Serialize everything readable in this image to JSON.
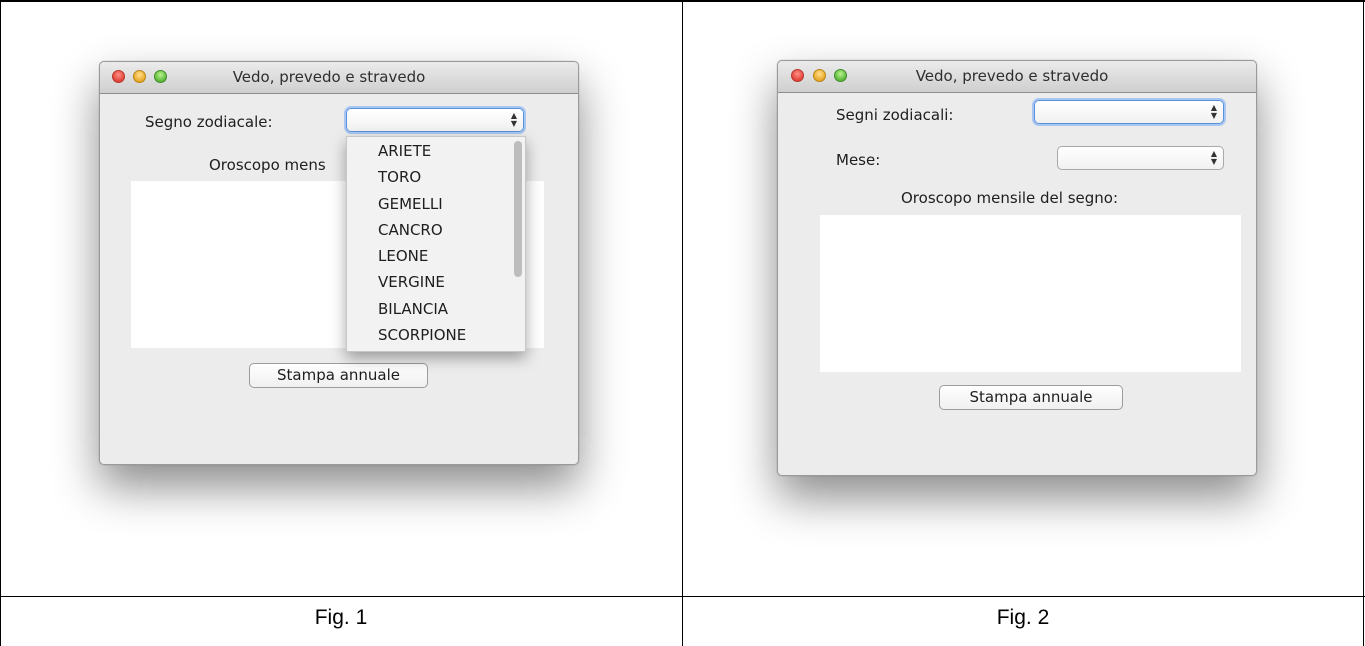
{
  "figures": [
    {
      "caption": "Fig. 1",
      "window": {
        "title": "Vedo, prevedo e stravedo",
        "sign_label": "Segno zodiacale:",
        "sign_value": "",
        "horoscope_label": "Oroscopo mens",
        "print_button": "Stampa annuale",
        "dropdown_items": [
          "ARIETE",
          "TORO",
          "GEMELLI",
          "CANCRO",
          "LEONE",
          "VERGINE",
          "BILANCIA",
          "SCORPIONE"
        ]
      }
    },
    {
      "caption": "Fig. 2",
      "window": {
        "title": "Vedo, prevedo e stravedo",
        "sign_label": "Segni zodiacali:",
        "sign_value": "",
        "month_label": "Mese:",
        "month_value": "",
        "horoscope_label": "Oroscopo mensile del segno:",
        "print_button": "Stampa annuale"
      }
    }
  ],
  "colors": {
    "close": "#e0443a",
    "minimize": "#e8a82a",
    "zoom": "#5cb83a",
    "focus_ring": "#5b91d9"
  },
  "icons": [
    "close-button-icon",
    "minimize-button-icon",
    "zoom-button-icon",
    "updown-arrows-icon",
    "scrollbar"
  ]
}
